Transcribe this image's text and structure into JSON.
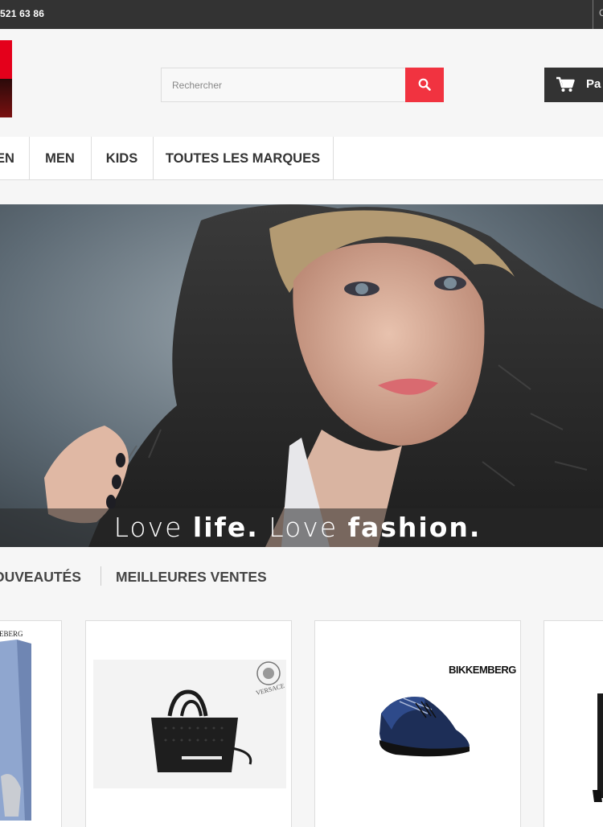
{
  "topbar": {
    "phone": "521 63 86"
  },
  "header": {
    "search": {
      "placeholder": "Rechercher"
    },
    "cart": {
      "label": "Pa"
    }
  },
  "nav": {
    "items": [
      {
        "label": "EN"
      },
      {
        "label": "MEN"
      },
      {
        "label": "KIDS"
      },
      {
        "label": "TOUTES LES MARQUES"
      }
    ]
  },
  "hero": {
    "caption": {
      "p1": "Love ",
      "p2": "life.",
      "p3": " Love ",
      "p4": "fashion."
    }
  },
  "tabs": {
    "items": [
      {
        "label": "OUVEAUTÉS"
      },
      {
        "label": "MEILLEURES VENTES"
      }
    ]
  },
  "products": [
    {
      "brand_label": "EBERG"
    },
    {
      "brand_label": "VERSACE"
    },
    {
      "brand_label": "BIKKEMBERGS"
    },
    {
      "brand_label": ""
    }
  ],
  "colors": {
    "accent": "#f13340",
    "dark": "#333333",
    "brand_red": "#e4001b"
  }
}
